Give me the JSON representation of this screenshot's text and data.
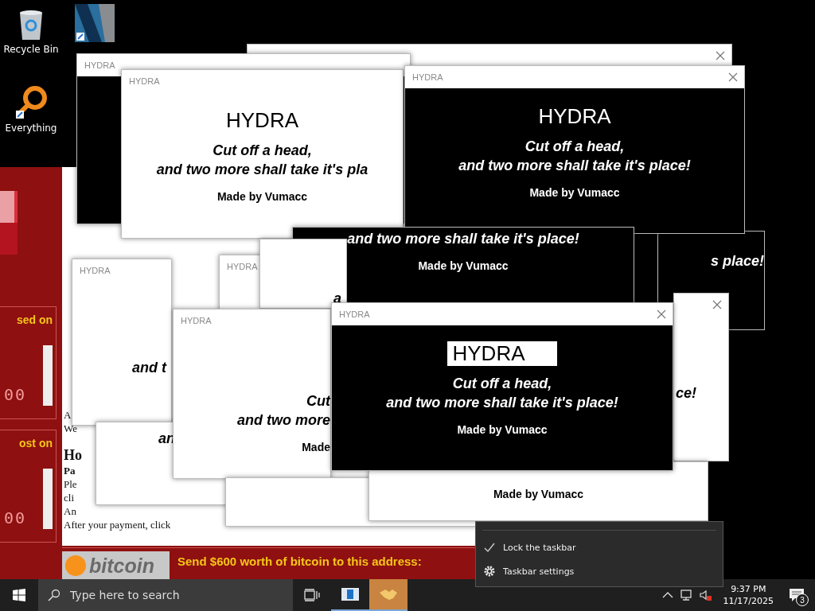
{
  "desktop_icons": [
    {
      "kind": "recycle",
      "label": "Recycle Bin"
    },
    {
      "kind": "video"
    },
    {
      "kind": "search",
      "label": "Everything"
    }
  ],
  "ransom_window": {
    "countdowns": [
      {
        "label": "sed on",
        "timer": "00"
      },
      {
        "label": "ost on",
        "timer": "00"
      }
    ],
    "body_lines": [
      {
        "kind": "plain",
        "text": "A"
      },
      {
        "kind": "plain",
        "text": "We"
      },
      {
        "kind": "heading",
        "text": "Ho"
      },
      {
        "kind": "bold",
        "text": "Pa"
      },
      {
        "kind": "plain",
        "text": "Ple"
      },
      {
        "kind": "plain",
        "text": "cli"
      },
      {
        "kind": "plain",
        "text": "An"
      },
      {
        "kind": "plain",
        "text": "After your payment, click"
      }
    ],
    "bitcoin_logo": "bitcoin",
    "send_label": "Send $600 worth of bitcoin to this address:"
  },
  "windows": [
    {
      "kind": "light"
    },
    {
      "kind": "dark",
      "title": "HYDRA"
    },
    {
      "kind": "light",
      "title": "HYDRA",
      "lines": [
        {
          "kind": "heading",
          "text": "HYDRA",
          "selected": false
        },
        {
          "kind": "tagline",
          "text": "Cut off a head,"
        },
        {
          "kind": "tagline",
          "text": "and two more shall take it's pla"
        },
        {
          "kind": "credit",
          "text": "Made by Vumacc"
        }
      ]
    },
    {
      "kind": "dark",
      "title": "HYDRA",
      "lines": [
        {
          "kind": "heading",
          "text": "HYDRA",
          "selected": false
        },
        {
          "kind": "tagline",
          "text": "Cut off a head,"
        },
        {
          "kind": "tagline",
          "text": "and two more shall take it's place!"
        },
        {
          "kind": "credit",
          "text": "Made by Vumacc"
        }
      ]
    },
    {
      "kind": "dark",
      "lines": [
        {
          "kind": "tagline",
          "text": "and two more shall take it's place!"
        },
        {
          "kind": "credit",
          "text": "Made by Vumacc"
        }
      ]
    },
    {
      "kind": "dark",
      "lines": [
        {
          "kind": "tagline",
          "text": "s place!"
        }
      ]
    },
    {
      "kind": "light",
      "lines": [
        {
          "kind": "tagline",
          "text": "a"
        }
      ]
    },
    {
      "kind": "light",
      "title": "HYDRA"
    },
    {
      "kind": "light",
      "title": "HYDRA",
      "lines": [
        {
          "kind": "tagline",
          "text": "and t"
        }
      ]
    },
    {
      "kind": "light",
      "lines": [
        {
          "kind": "tagline",
          "text": "ce!"
        }
      ]
    },
    {
      "kind": "dark",
      "title": "HYDRA",
      "lines": [
        {
          "kind": "heading",
          "text": "HYDRA",
          "selected": true
        },
        {
          "kind": "tagline",
          "text": "Cut off a head,"
        },
        {
          "kind": "tagline",
          "text": "and two more shall take it's place!"
        },
        {
          "kind": "credit",
          "text": "Made by Vumacc"
        }
      ]
    },
    {
      "kind": "light",
      "title": "HYDRA",
      "lines": [
        {
          "kind": "tagline",
          "text": "Cut"
        },
        {
          "kind": "tagline",
          "text": "and two more"
        },
        {
          "kind": "credit",
          "text": "Made"
        }
      ]
    },
    {
      "kind": "light",
      "lines": [
        {
          "kind": "tagline",
          "text": "an"
        }
      ]
    },
    {
      "kind": "light",
      "lines": [
        {
          "kind": "credit",
          "text": "Made by Vumacc"
        }
      ]
    },
    {
      "kind": "light"
    }
  ],
  "context_menu": {
    "items": [
      {
        "kind": "check",
        "label": "Lock the taskbar",
        "checked": true
      },
      {
        "kind": "settings",
        "label": "Taskbar settings"
      }
    ]
  },
  "taskbar": {
    "search": {
      "placeholder": "Type here to search"
    },
    "apps": [
      {
        "kind": "window",
        "selected": false
      },
      {
        "kind": "handshake",
        "selected": true
      }
    ],
    "clock": {
      "time": "9:37 PM",
      "date": "11/17/2025"
    },
    "notifications": {
      "count": "3"
    }
  }
}
